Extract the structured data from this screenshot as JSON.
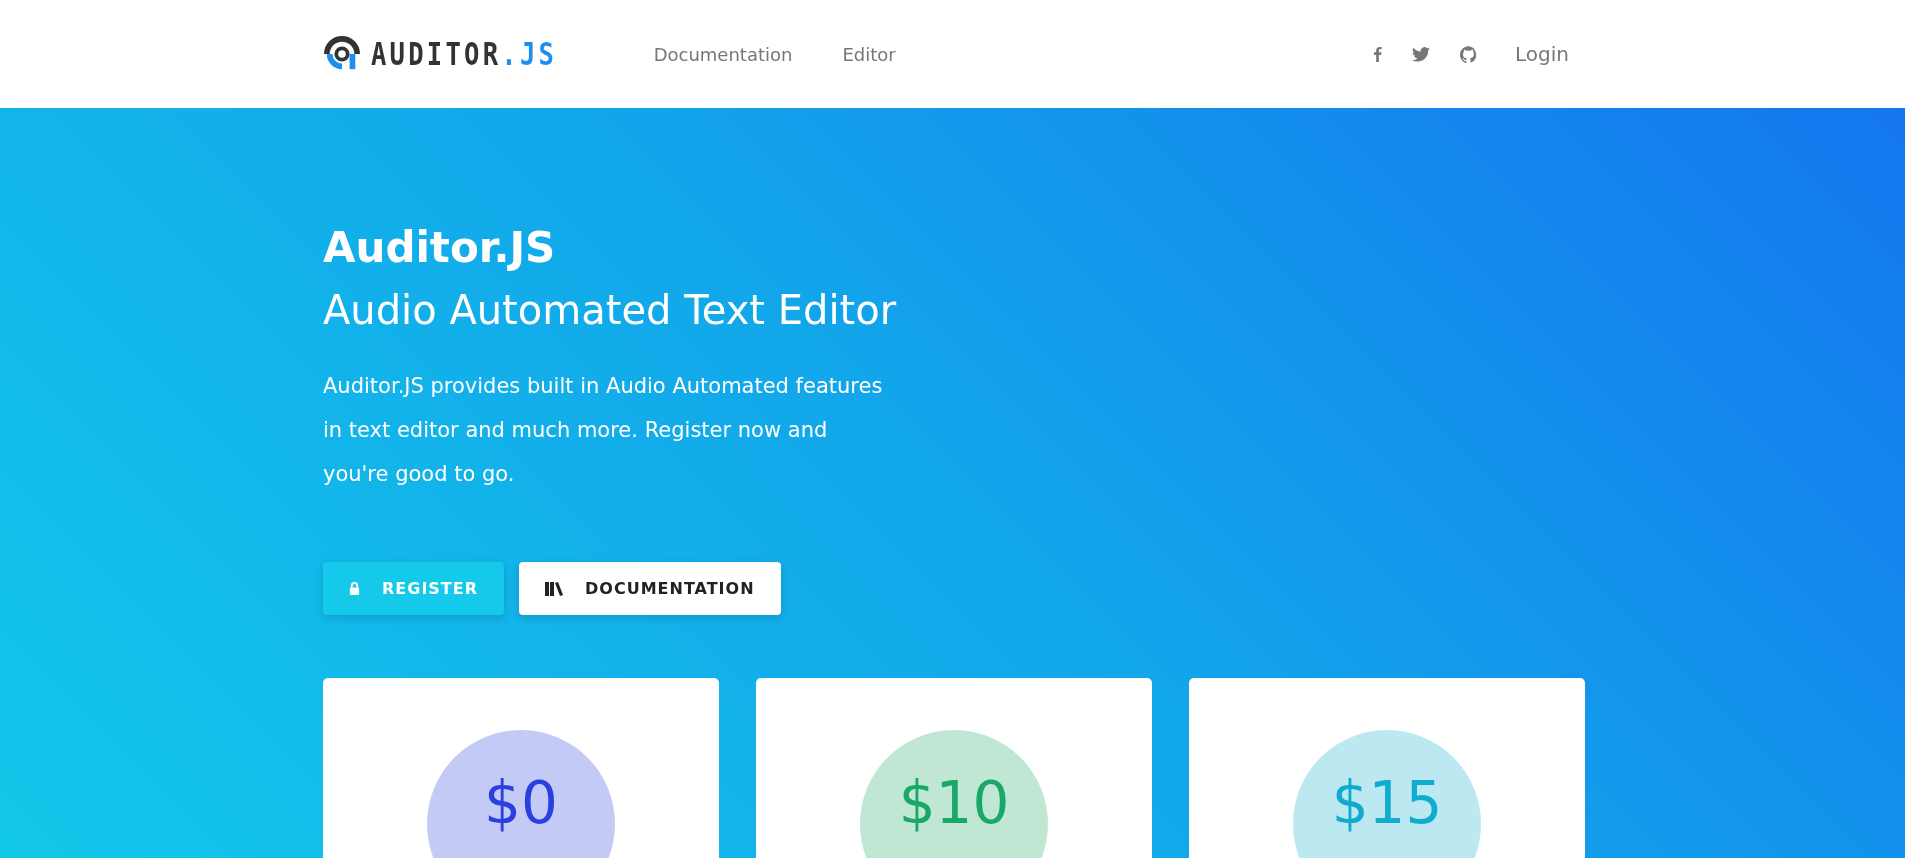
{
  "header": {
    "logo": {
      "text": "AUDITOR",
      "accent": ".JS"
    },
    "nav": [
      {
        "label": "Documentation"
      },
      {
        "label": "Editor"
      }
    ],
    "social": [
      {
        "kind": "facebook"
      },
      {
        "kind": "twitter"
      },
      {
        "kind": "github"
      }
    ],
    "login": "Login"
  },
  "hero": {
    "title": "Auditor.JS",
    "subtitle": "Audio Automated Text Editor",
    "description": "Auditor.JS provides built in Audio Automated features in text editor and much more. Register now and you're good to go.",
    "buttons": [
      {
        "kind": "primary",
        "label": "REGISTER"
      },
      {
        "kind": "secondary",
        "label": "DOCUMENTATION"
      }
    ]
  },
  "plans": [
    {
      "price": "$0",
      "color": "#2b3fe0"
    },
    {
      "price": "$10",
      "color": "#1aa866"
    },
    {
      "price": "$15",
      "color": "#10acd0"
    }
  ]
}
